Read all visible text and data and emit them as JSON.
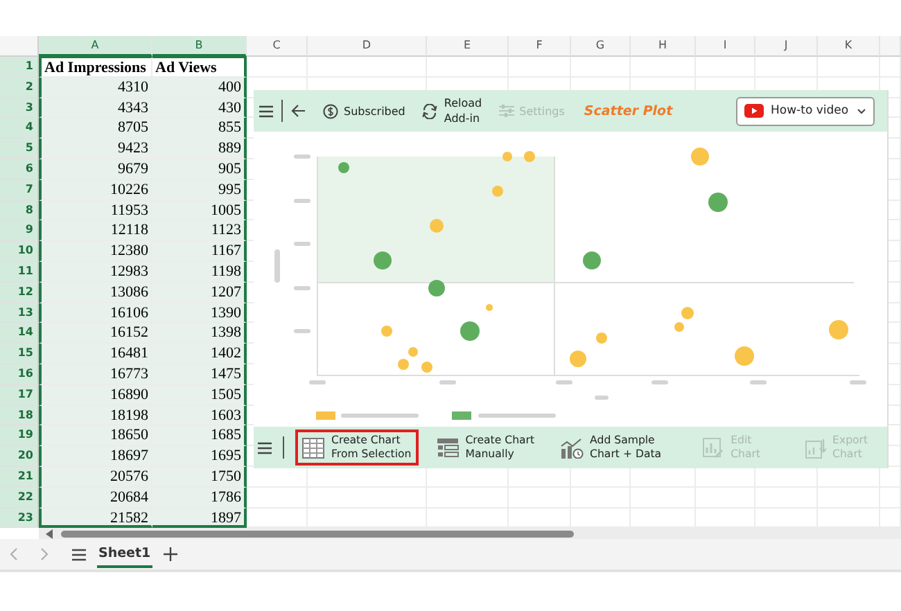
{
  "columns": [
    {
      "label": "A",
      "selected": true
    },
    {
      "label": "B",
      "selected": true
    },
    {
      "label": "C",
      "selected": false
    },
    {
      "label": "D",
      "selected": false
    },
    {
      "label": "E",
      "selected": false
    },
    {
      "label": "F",
      "selected": false
    },
    {
      "label": "G",
      "selected": false
    },
    {
      "label": "H",
      "selected": false
    },
    {
      "label": "I",
      "selected": false
    },
    {
      "label": "J",
      "selected": false
    },
    {
      "label": "K",
      "selected": false
    }
  ],
  "rows": [
    {
      "number": "1",
      "selected": true,
      "cells": [
        "Ad Impressions",
        "Ad Views"
      ]
    },
    {
      "number": "2",
      "selected": true,
      "cells": [
        "4310",
        "400"
      ]
    },
    {
      "number": "3",
      "selected": true,
      "cells": [
        "4343",
        "430"
      ]
    },
    {
      "number": "4",
      "selected": true,
      "cells": [
        "8705",
        "855"
      ]
    },
    {
      "number": "5",
      "selected": true,
      "cells": [
        "9423",
        "889"
      ]
    },
    {
      "number": "6",
      "selected": true,
      "cells": [
        "9679",
        "905"
      ]
    },
    {
      "number": "7",
      "selected": true,
      "cells": [
        "10226",
        "995"
      ]
    },
    {
      "number": "8",
      "selected": true,
      "cells": [
        "11953",
        "1005"
      ]
    },
    {
      "number": "9",
      "selected": true,
      "cells": [
        "12118",
        "1123"
      ]
    },
    {
      "number": "10",
      "selected": true,
      "cells": [
        "12380",
        "1167"
      ]
    },
    {
      "number": "11",
      "selected": true,
      "cells": [
        "12983",
        "1198"
      ]
    },
    {
      "number": "12",
      "selected": true,
      "cells": [
        "13086",
        "1207"
      ]
    },
    {
      "number": "13",
      "selected": true,
      "cells": [
        "16106",
        "1390"
      ]
    },
    {
      "number": "14",
      "selected": true,
      "cells": [
        "16152",
        "1398"
      ]
    },
    {
      "number": "15",
      "selected": true,
      "cells": [
        "16481",
        "1402"
      ]
    },
    {
      "number": "16",
      "selected": true,
      "cells": [
        "16773",
        "1475"
      ]
    },
    {
      "number": "17",
      "selected": true,
      "cells": [
        "16890",
        "1505"
      ]
    },
    {
      "number": "18",
      "selected": true,
      "cells": [
        "18198",
        "1603"
      ]
    },
    {
      "number": "19",
      "selected": true,
      "cells": [
        "18650",
        "1685"
      ]
    },
    {
      "number": "20",
      "selected": true,
      "cells": [
        "18697",
        "1695"
      ]
    },
    {
      "number": "21",
      "selected": true,
      "cells": [
        "20576",
        "1750"
      ]
    },
    {
      "number": "22",
      "selected": true,
      "cells": [
        "20684",
        "1786"
      ]
    },
    {
      "number": "23",
      "selected": true,
      "cells": [
        "21582",
        "1897"
      ]
    }
  ],
  "addin": {
    "toolbar": [
      {
        "kind": "menu"
      },
      {
        "kind": "back"
      },
      {
        "kind": "subscription",
        "label": "Subscribed",
        "disabled": false
      },
      {
        "kind": "reload",
        "label": "Reload\nAdd-in",
        "disabled": false
      },
      {
        "kind": "settings",
        "label": "Settings",
        "disabled": true
      }
    ],
    "title": "Scatter Plot",
    "video_button": "How-to video",
    "actions": [
      {
        "kind": "from-selection",
        "label": "Create Chart\nFrom Selection",
        "disabled": false,
        "highlighted": true
      },
      {
        "kind": "manual",
        "label": "Create Chart\nManually",
        "disabled": false,
        "highlighted": false
      },
      {
        "kind": "sample",
        "label": "Add Sample\nChart + Data",
        "disabled": false,
        "highlighted": false
      },
      {
        "kind": "edit",
        "label": "Edit\nChart",
        "disabled": true,
        "highlighted": false
      },
      {
        "kind": "export",
        "label": "Export\nChart",
        "disabled": true,
        "highlighted": false
      }
    ]
  },
  "sheet_tabs": [
    {
      "label": "Sheet1",
      "selected": true
    }
  ]
}
